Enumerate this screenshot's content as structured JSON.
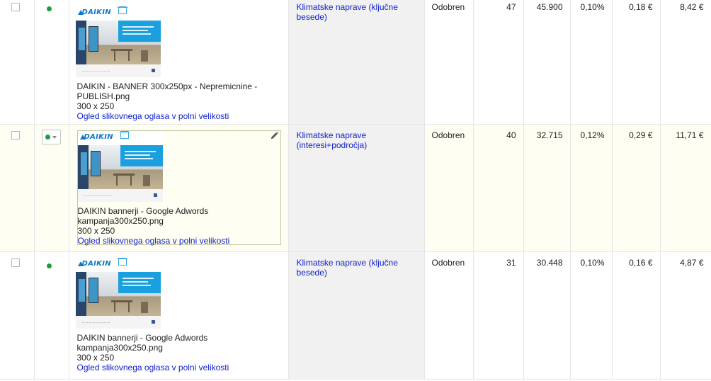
{
  "rows": [
    {
      "ad_name": "DAIKIN - BANNER 300x250px - Nepremicnine - PUBLISH.png",
      "ad_size": "300 x 250",
      "ad_link": "Ogled slikovnega oglasa v polni velikosti",
      "ad_group": "Klimatske naprave (ključne besede)",
      "status": "Odobren",
      "clicks": "47",
      "impressions": "45.900",
      "ctr": "0,10%",
      "avg_cpc": "0,18 €",
      "cost": "8,42 €",
      "status_color": "#1e9b3a"
    },
    {
      "ad_name": "DAIKIN bannerji - Google Adwords kampanja300x250.png",
      "ad_size": "300 x 250",
      "ad_link": "Ogled slikovnega oglasa v polni velikosti",
      "ad_group": "Klimatske naprave (interesi+področja)",
      "status": "Odobren",
      "clicks": "40",
      "impressions": "32.715",
      "ctr": "0,12%",
      "avg_cpc": "0,29 €",
      "cost": "11,71 €",
      "status_color": "#1e9b3a"
    },
    {
      "ad_name": "DAIKIN bannerji - Google Adwords kampanja300x250.png",
      "ad_size": "300 x 250",
      "ad_link": "Ogled slikovnega oglasa v polni velikosti",
      "ad_group": "Klimatske naprave (ključne besede)",
      "status": "Odobren",
      "clicks": "31",
      "impressions": "30.448",
      "ctr": "0,10%",
      "avg_cpc": "0,16 €",
      "cost": "4,87 €",
      "status_color": "#1e9b3a"
    }
  ],
  "banner": {
    "logo_text": "DAIKIN",
    "brand_color": "#0f7ac3",
    "accent_color": "#1aa0de",
    "icons": [
      "pencil-icon",
      "checkbox",
      "status-dot-icon",
      "chevron-down-icon",
      "facebook-icon"
    ]
  }
}
